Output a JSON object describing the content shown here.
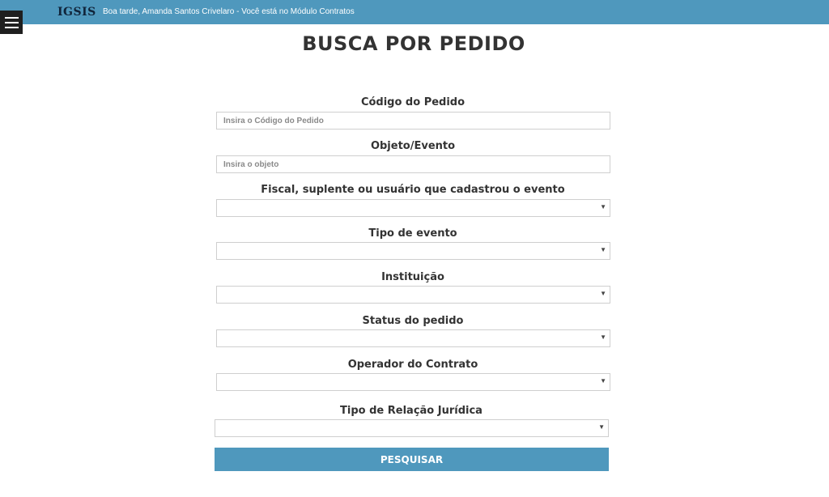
{
  "header": {
    "brand": "IGSIS",
    "greeting": "Boa tarde, Amanda Santos Crivelaro - Você está no Módulo Contratos",
    "menu_icon": "hamburger-menu-icon"
  },
  "page": {
    "title": "BUSCA POR PEDIDO"
  },
  "form": {
    "codigo": {
      "label": "Código do Pedido",
      "placeholder": "Insira o Código do Pedido",
      "value": ""
    },
    "objeto": {
      "label": "Objeto/Evento",
      "placeholder": "Insira o objeto",
      "value": ""
    },
    "fiscal": {
      "label": "Fiscal, suplente ou usuário que cadastrou o evento",
      "value": ""
    },
    "tipo_evento": {
      "label": "Tipo de evento",
      "value": ""
    },
    "instituicao": {
      "label": "Instituição",
      "value": ""
    },
    "status": {
      "label": "Status do pedido",
      "value": ""
    },
    "operador": {
      "label": "Operador do Contrato",
      "value": ""
    },
    "relacao": {
      "label": "Tipo de Relação Jurídica",
      "value": ""
    },
    "submit_label": "PESQUISAR"
  },
  "colors": {
    "accent": "#4f98bd",
    "menu_button": "#1f1f1f",
    "title_text": "#333333"
  }
}
